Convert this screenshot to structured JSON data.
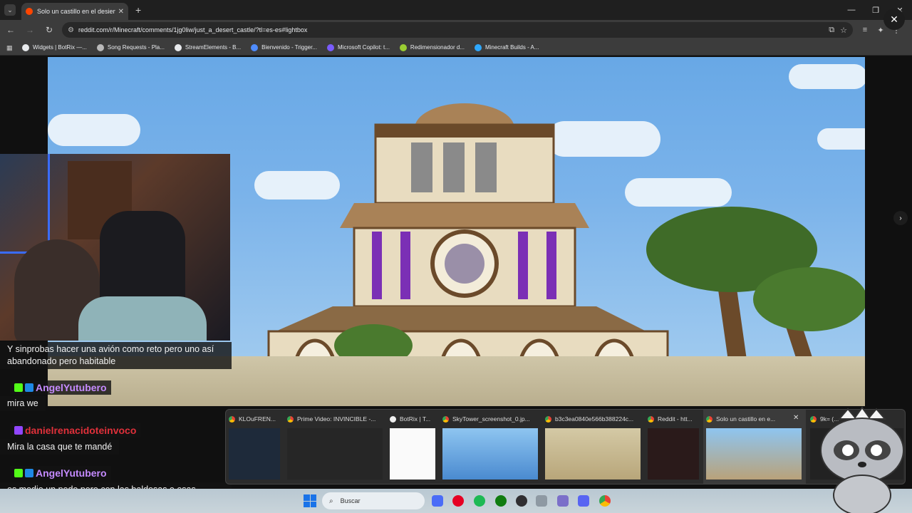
{
  "browser": {
    "tab_title": "Solo un castillo en el desierto.",
    "url": "reddit.com/r/Minecraft/comments/1jg0liw/just_a_desert_castle/?tl=es-es#lightbox",
    "bookmarks": [
      {
        "label": "Widgets | BotRix —...",
        "color": "#e8eaed"
      },
      {
        "label": "Song Requests - Pla...",
        "color": "#b9b9b9"
      },
      {
        "label": "StreamElements - B...",
        "color": "#e8eaed"
      },
      {
        "label": "Bienvenido - Trigger...",
        "color": "#4f8cff"
      },
      {
        "label": "Microsoft Copilot: t...",
        "color": "#7a5cff"
      },
      {
        "label": "Redimensionador d...",
        "color": "#9acd32"
      },
      {
        "label": "Minecraft Builds - A...",
        "color": "#2ea8ff"
      }
    ]
  },
  "chat": {
    "messages": [
      {
        "text": "Y sinprobas hacer una avión como reto pero uno así abandonado pero habitable"
      },
      {
        "user": "AngelYutubero",
        "user_color": "#c58bff",
        "text": "mira we"
      },
      {
        "user": "danielrenacidoteinvoco",
        "user_color": "#e0303a",
        "text": "Mira la casa que te mandé"
      },
      {
        "user": "AngelYutubero",
        "user_color": "#c58bff",
        "text": "es medio un pedo pero con las baldosas o esas madres que son de bamboo te da un paro"
      }
    ]
  },
  "task_previews": [
    {
      "title": "KLOuFREN..."
    },
    {
      "title": "Prime Video: INVINCIBLE -..."
    },
    {
      "title": "BotRix | T..."
    },
    {
      "title": "SkyTower_screenshot_0.jp..."
    },
    {
      "title": "b3c3ea0840e566b388224c..."
    },
    {
      "title": "Reddit - htt..."
    },
    {
      "title": "Solo un castillo en e..."
    },
    {
      "title": "9k= (..."
    }
  ],
  "taskbar": {
    "search_placeholder": "Buscar"
  },
  "colors": {
    "reddit_orange": "#ff4500",
    "castle_purple": "#7b2fb5",
    "sandstone": "#e8dcc0"
  }
}
